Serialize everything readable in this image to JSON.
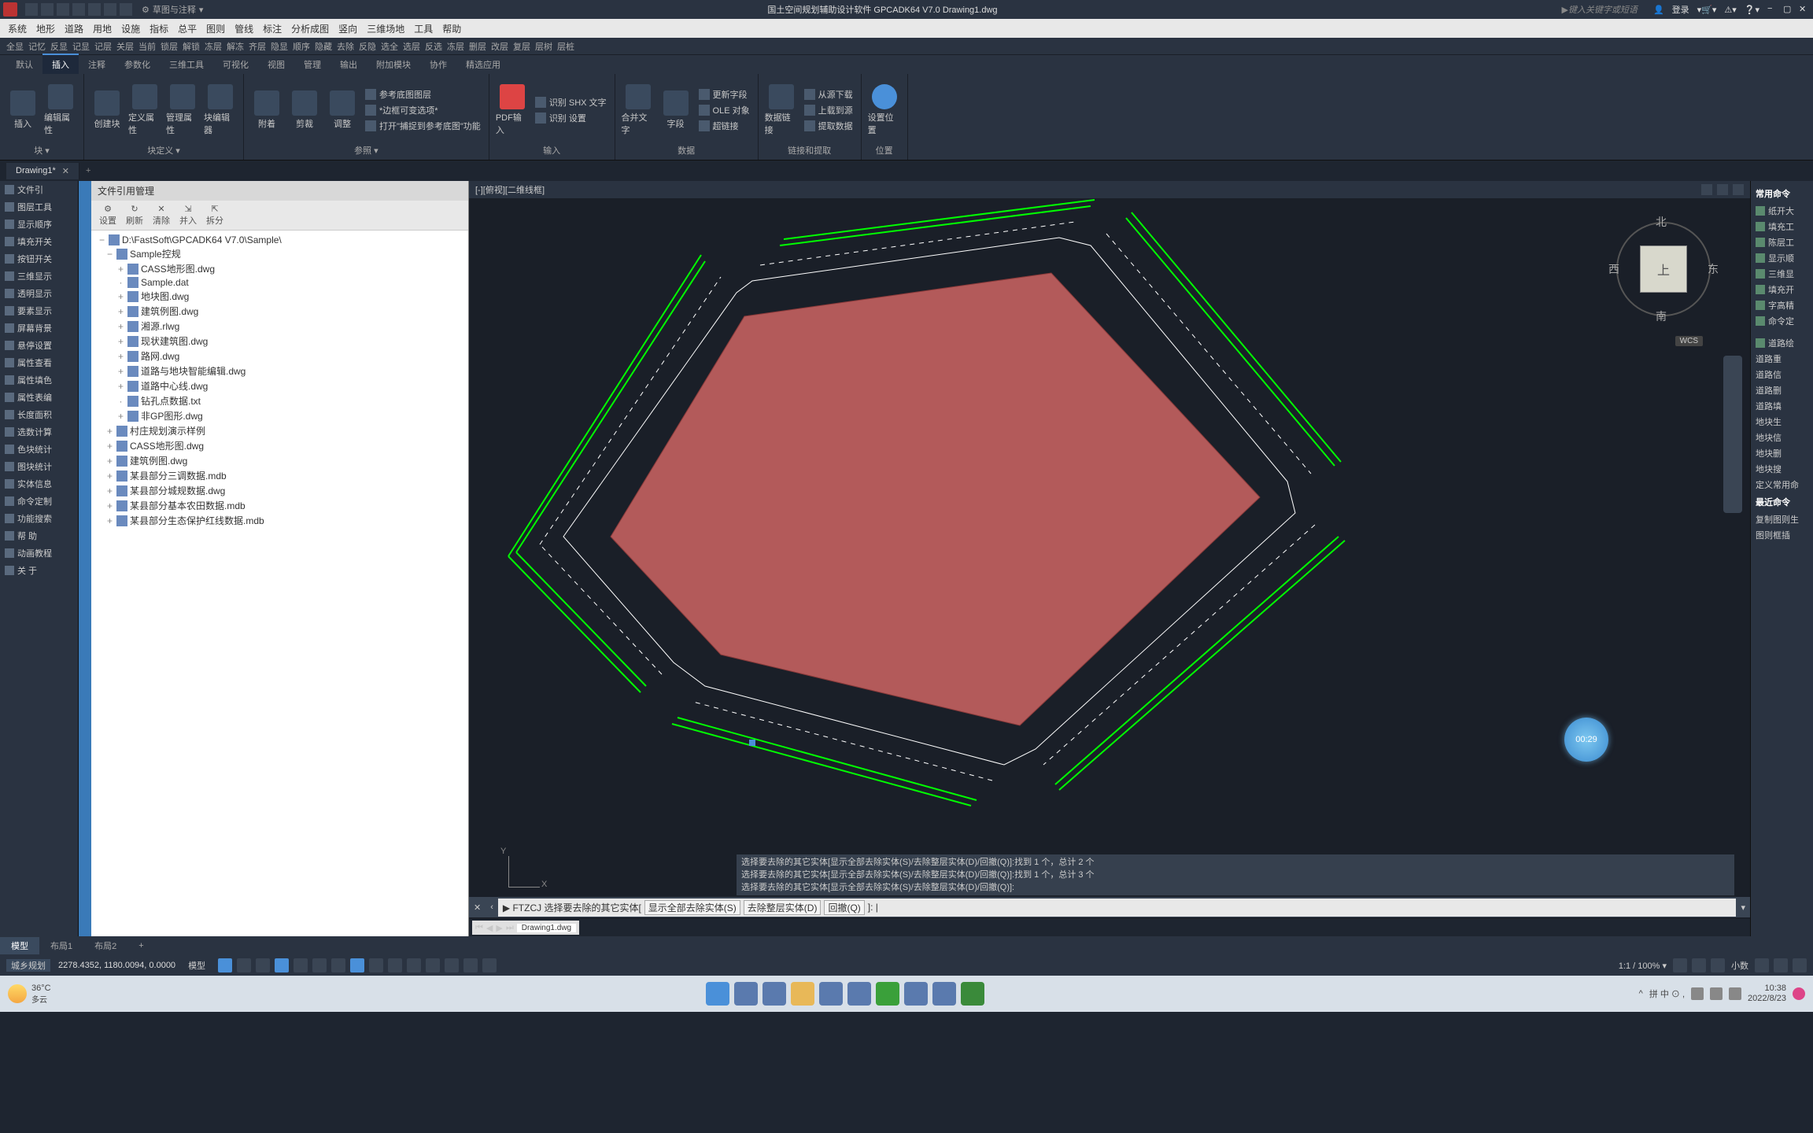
{
  "titlebar": {
    "workspace": "草图与注释",
    "title": "国土空间规划辅助设计软件 GPCADK64 V7.0   Drawing1.dwg",
    "search_placeholder": "键入关键字或短语",
    "login": "登录"
  },
  "menubar": [
    "系统",
    "地形",
    "道路",
    "用地",
    "设施",
    "指标",
    "总平",
    "图则",
    "管线",
    "标注",
    "分析成图",
    "竖向",
    "三维场地",
    "工具",
    "帮助"
  ],
  "toolbar_row": [
    "全显",
    "记忆",
    "反显",
    "记显",
    "记层",
    "关层",
    "当前",
    "锁层",
    "解锁",
    "冻层",
    "解冻",
    "齐层",
    "隐显",
    "顺序",
    "隐藏",
    "去除",
    "反隐",
    "选全",
    "选层",
    "反选",
    "冻层",
    "删层",
    "改层",
    "复层",
    "层树",
    "层桩"
  ],
  "ribbon_tabs": [
    "默认",
    "插入",
    "注释",
    "参数化",
    "三维工具",
    "可视化",
    "视图",
    "管理",
    "输出",
    "附加模块",
    "协作",
    "精选应用"
  ],
  "ribbon_active": "插入",
  "ribbon": {
    "panel1": {
      "label": "块 ▾",
      "items": [
        "插入",
        "编辑属性"
      ]
    },
    "panel2": {
      "label": "块定义 ▾",
      "items": [
        "创建块",
        "定义属性",
        "管理属性",
        "块编辑器"
      ]
    },
    "panel3": {
      "label": "参照 ▾",
      "items": [
        "附着",
        "剪裁",
        "调整"
      ],
      "rows": [
        "参考底图图层",
        "*边框可变选项*",
        "打开\"捕捉到参考底图\"功能"
      ]
    },
    "panel4": {
      "label": "输入",
      "items": [
        "PDF输入"
      ],
      "rows": [
        "识别 SHX 文字",
        "识别 设置"
      ]
    },
    "panel5": {
      "label": "",
      "items": [
        "合并文字",
        "字段"
      ],
      "rows": [
        "更新字段",
        "OLE 对象",
        "超链接"
      ]
    },
    "panel6": {
      "label": "数据",
      "items": [
        "数据链接"
      ]
    },
    "panel7": {
      "label": "链接和提取",
      "items": [],
      "rows": [
        "从源下载",
        "上载到源",
        "提取数据"
      ]
    },
    "panel8": {
      "label": "位置",
      "items": [
        "设置位置"
      ]
    }
  },
  "doc_tab": "Drawing1*",
  "left_panel": [
    "文件引",
    "图层工具",
    "显示顺序",
    "填充开关",
    "按钮开关",
    "三维显示",
    "透明显示",
    "要素显示",
    "屏幕背景",
    "悬停设置",
    "属性查看",
    "属性填色",
    "属性表编",
    "长度面积",
    "选数计算",
    "色块统计",
    "图块统计",
    "实体信息",
    "命令定制",
    "功能搜索",
    "帮   助",
    "动画教程",
    "关   于"
  ],
  "file_manager": {
    "title": "文件引用管理",
    "buttons": [
      "设置",
      "刷新",
      "清除",
      "并入",
      "拆分"
    ],
    "root": "D:\\FastSoft\\GPCADK64 V7.0\\Sample\\",
    "tree": [
      {
        "level": 1,
        "exp": "−",
        "label": "Sample控规"
      },
      {
        "level": 2,
        "exp": "+",
        "label": "CASS地形图.dwg"
      },
      {
        "level": 2,
        "exp": "",
        "label": "Sample.dat"
      },
      {
        "level": 2,
        "exp": "+",
        "label": "地块图.dwg"
      },
      {
        "level": 2,
        "exp": "+",
        "label": "建筑例图.dwg"
      },
      {
        "level": 2,
        "exp": "+",
        "label": "湘源.rlwg"
      },
      {
        "level": 2,
        "exp": "+",
        "label": "现状建筑图.dwg"
      },
      {
        "level": 2,
        "exp": "+",
        "label": "路网.dwg"
      },
      {
        "level": 2,
        "exp": "+",
        "label": "道路与地块智能编辑.dwg"
      },
      {
        "level": 2,
        "exp": "+",
        "label": "道路中心线.dwg"
      },
      {
        "level": 2,
        "exp": "",
        "label": "钻孔点数据.txt"
      },
      {
        "level": 2,
        "exp": "+",
        "label": "非GP图形.dwg"
      },
      {
        "level": 1,
        "exp": "+",
        "label": "村庄规划演示样例"
      },
      {
        "level": 1,
        "exp": "+",
        "label": "CASS地形图.dwg"
      },
      {
        "level": 1,
        "exp": "+",
        "label": "建筑例图.dwg"
      },
      {
        "level": 1,
        "exp": "+",
        "label": "某县部分三调数据.mdb"
      },
      {
        "level": 1,
        "exp": "+",
        "label": "某县部分城规数据.dwg"
      },
      {
        "level": 1,
        "exp": "+",
        "label": "某县部分基本农田数据.mdb"
      },
      {
        "level": 1,
        "exp": "+",
        "label": "某县部分生态保护红线数据.mdb"
      }
    ]
  },
  "viewport": {
    "label": "[-][俯视][二维线框]",
    "compass": {
      "n": "北",
      "s": "南",
      "e": "东",
      "w": "西",
      "top": "上"
    },
    "wcs": "WCS",
    "clock": "00:29",
    "sheet_tab": "Drawing1.dwg"
  },
  "cmd_history": [
    "选择要去除的其它实体[显示全部去除实体(S)/去除整层实体(D)/回撤(Q)]:找到 1 个，总计 2 个",
    "选择要去除的其它实体[显示全部去除实体(S)/去除整层实体(D)/回撤(Q)]:找到 1 个，总计 3 个",
    "选择要去除的其它实体[显示全部去除实体(S)/去除整层实体(D)/回撤(Q)]:"
  ],
  "cmdline": {
    "prefix": "▶ FTZCJ 选择要去除的其它实体[",
    "opts": [
      "显示全部去除实体(S)",
      "去除整层实体(D)",
      "回撤(Q)"
    ],
    "suffix": "]: |"
  },
  "right_panel": {
    "title1": "常用命令",
    "group1": [
      "纸开大",
      "填充工",
      "陈层工",
      "显示顺",
      "三维显",
      "填充开",
      "字高精",
      "命令定"
    ],
    "group2": [
      "道路绘",
      "道路重",
      "道路信",
      "道路删",
      "道路填",
      "地块生",
      "地块信",
      "地块删",
      "地块搜",
      "定义常用命"
    ],
    "title2": "最近命令",
    "group3": [
      "复制图则生",
      "图则框插"
    ]
  },
  "layout_tabs": [
    "模型",
    "布局1",
    "布局2"
  ],
  "statusbar": {
    "left_label": "城乡规划",
    "coords": "2278.4352, 1180.0094, 0.0000",
    "model": "模型",
    "scale": "1:1 / 100% ▾",
    "decimal": "小数"
  },
  "taskbar": {
    "temp": "36°C",
    "weather": "多云",
    "ime": "拼  中 ⊙ ,",
    "time": "10:38",
    "date": "2022/8/23"
  }
}
